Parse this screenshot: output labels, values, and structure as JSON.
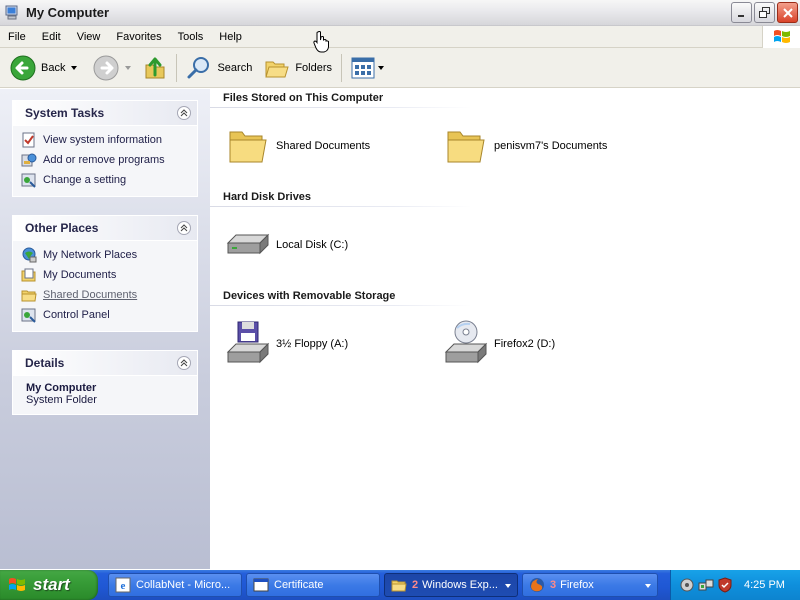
{
  "window": {
    "title": "My Computer",
    "controls": {
      "minimize": "minimize",
      "restore": "restore",
      "close": "close"
    }
  },
  "menubar": {
    "items": [
      "File",
      "Edit",
      "View",
      "Favorites",
      "Tools",
      "Help"
    ]
  },
  "toolbar": {
    "back_label": "Back",
    "search_label": "Search",
    "folders_label": "Folders"
  },
  "sidebar": {
    "system_tasks": {
      "title": "System Tasks",
      "items": [
        {
          "label": "View system information",
          "icon": "system-info-icon"
        },
        {
          "label": "Add or remove programs",
          "icon": "add-remove-programs-icon"
        },
        {
          "label": "Change a setting",
          "icon": "control-panel-icon"
        }
      ]
    },
    "other_places": {
      "title": "Other Places",
      "items": [
        {
          "label": "My Network Places",
          "icon": "network-places-icon"
        },
        {
          "label": "My Documents",
          "icon": "my-documents-icon"
        },
        {
          "label": "Shared Documents",
          "icon": "folder-icon"
        },
        {
          "label": "Control Panel",
          "icon": "control-panel-icon"
        }
      ]
    },
    "details": {
      "title": "Details",
      "name": "My Computer",
      "type": "System Folder"
    }
  },
  "content": {
    "groups": [
      {
        "title": "Files Stored on This Computer",
        "items": [
          {
            "label": "Shared Documents",
            "icon": "folder-icon"
          },
          {
            "label": "penisvm7's Documents",
            "icon": "folder-icon"
          }
        ]
      },
      {
        "title": "Hard Disk Drives",
        "items": [
          {
            "label": "Local Disk (C:)",
            "icon": "hard-disk-icon"
          }
        ]
      },
      {
        "title": "Devices with Removable Storage",
        "items": [
          {
            "label": "3½ Floppy (A:)",
            "icon": "floppy-drive-icon"
          },
          {
            "label": "Firefox2 (D:)",
            "icon": "cd-drive-icon"
          }
        ]
      }
    ]
  },
  "taskbar": {
    "start_label": "start",
    "buttons": [
      {
        "label": "CollabNet - Micro...",
        "icon": "ie-icon"
      },
      {
        "label": "Certificate",
        "icon": "window-icon"
      },
      {
        "label": "Windows Exp...",
        "count": "2",
        "icon": "folder-icon",
        "active": true
      },
      {
        "label": "Firefox",
        "count": "3",
        "icon": "firefox-icon"
      }
    ],
    "clock": "4:25 PM"
  },
  "colors": {
    "title_gradient_top": "#f7f7f7",
    "close_button": "#d9432a",
    "taskbar_blue": "#245edb",
    "start_green": "#379c37",
    "tray_blue": "#0f8fdc",
    "sidebar_text": "#21214a"
  }
}
